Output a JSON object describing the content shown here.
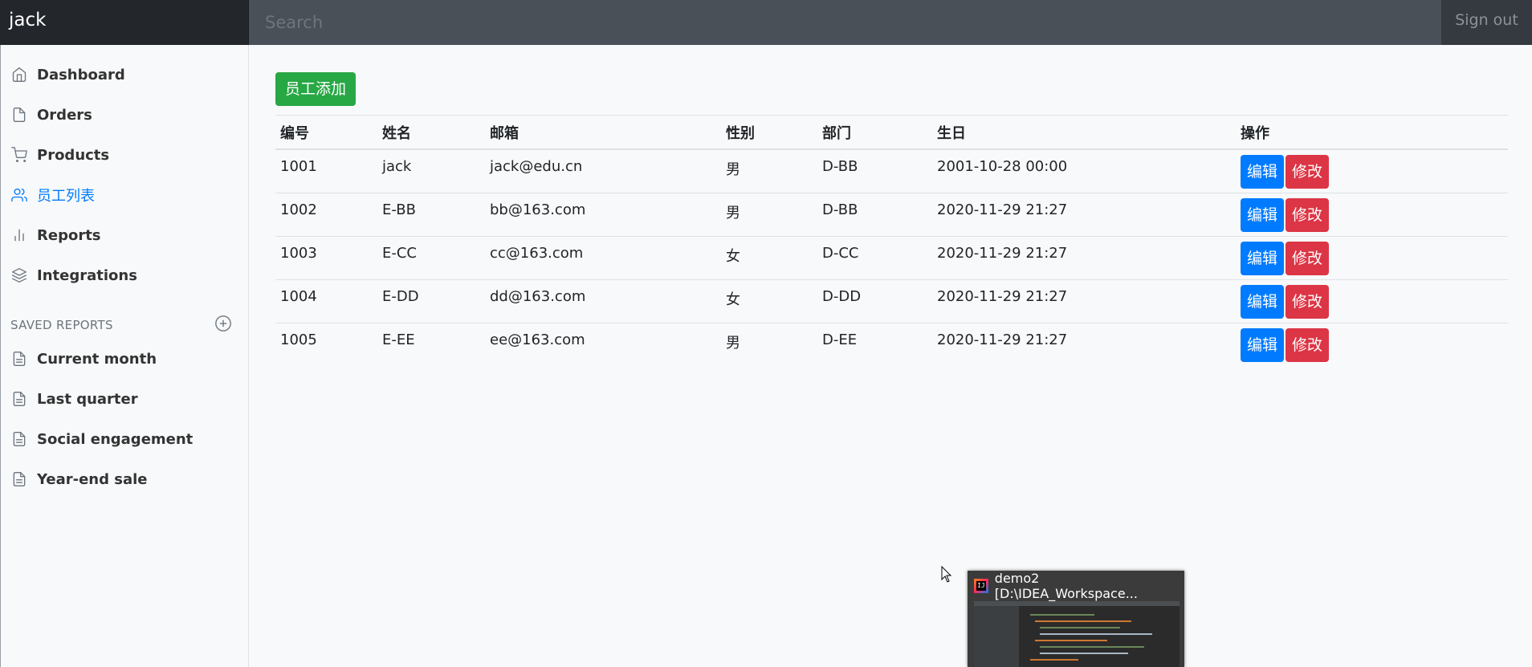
{
  "navbar": {
    "brand": "jack",
    "search_placeholder": "Search",
    "signout_label": "Sign out"
  },
  "sidebar": {
    "items": [
      {
        "label": "Dashboard",
        "icon": "home-icon"
      },
      {
        "label": "Orders",
        "icon": "file-icon"
      },
      {
        "label": "Products",
        "icon": "shopping-cart-icon"
      },
      {
        "label": "员工列表",
        "icon": "users-icon",
        "active": true
      },
      {
        "label": "Reports",
        "icon": "bar-chart-icon"
      },
      {
        "label": "Integrations",
        "icon": "layers-icon"
      }
    ],
    "saved_heading": "SAVED REPORTS",
    "saved_items": [
      {
        "label": "Current month",
        "icon": "file-text-icon"
      },
      {
        "label": "Last quarter",
        "icon": "file-text-icon"
      },
      {
        "label": "Social engagement",
        "icon": "file-text-icon"
      },
      {
        "label": "Year-end sale",
        "icon": "file-text-icon"
      }
    ]
  },
  "main": {
    "add_button": "员工添加",
    "columns": [
      "编号",
      "姓名",
      "邮箱",
      "性别",
      "部门",
      "生日",
      "操作"
    ],
    "rows": [
      {
        "id": "1001",
        "name": "jack",
        "email": "jack@edu.cn",
        "gender": "男",
        "dept": "D-BB",
        "birth": "2001-10-28 00:00"
      },
      {
        "id": "1002",
        "name": "E-BB",
        "email": "bb@163.com",
        "gender": "男",
        "dept": "D-BB",
        "birth": "2020-11-29 21:27"
      },
      {
        "id": "1003",
        "name": "E-CC",
        "email": "cc@163.com",
        "gender": "女",
        "dept": "D-CC",
        "birth": "2020-11-29 21:27"
      },
      {
        "id": "1004",
        "name": "E-DD",
        "email": "dd@163.com",
        "gender": "女",
        "dept": "D-DD",
        "birth": "2020-11-29 21:27"
      },
      {
        "id": "1005",
        "name": "E-EE",
        "email": "ee@163.com",
        "gender": "男",
        "dept": "D-EE",
        "birth": "2020-11-29 21:27"
      }
    ],
    "edit_label": "编辑",
    "modify_label": "修改"
  },
  "taskbar_preview": {
    "title": "demo2 [D:\\IDEA_Workspace...",
    "icon": "intellij-idea-icon"
  },
  "colors": {
    "navbar": "#343a40",
    "active": "#007bff",
    "success": "#28a745",
    "danger": "#dc3545"
  }
}
